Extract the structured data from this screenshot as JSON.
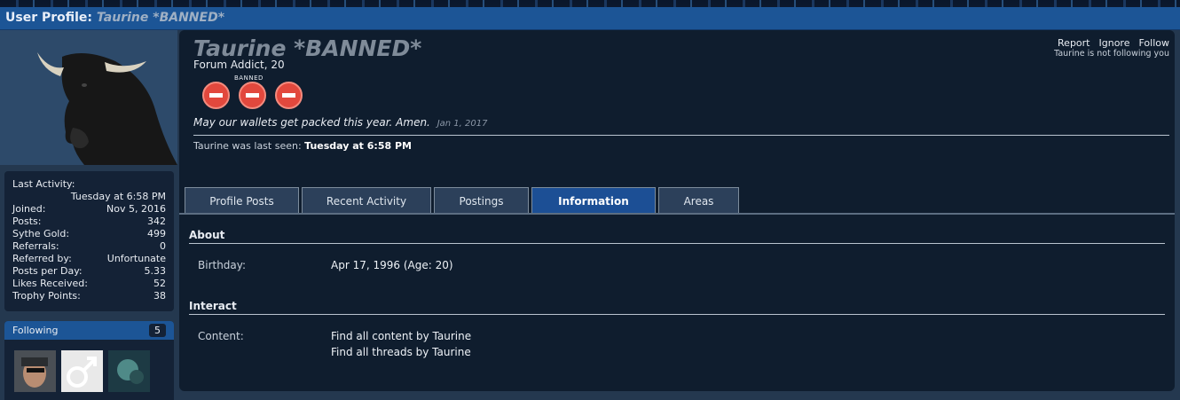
{
  "header": {
    "title_prefix": "User Profile:",
    "title_user": "Taurine *BANNED*"
  },
  "profile": {
    "name": "Taurine *BANNED*",
    "subtitle": "Forum Addict, 20",
    "badge_label": "BANNED",
    "status_text": "May our wallets get packed this year. Amen.",
    "status_date": "Jan 1, 2017",
    "last_seen_label": "Taurine was last seen:",
    "last_seen_value": "Tuesday at 6:58 PM"
  },
  "actions": {
    "report": "Report",
    "ignore": "Ignore",
    "follow": "Follow",
    "note": "Taurine is not following you"
  },
  "stats": {
    "last_activity_label": "Last Activity:",
    "last_activity_value": "Tuesday at 6:58 PM",
    "rows": [
      {
        "label": "Joined:",
        "value": "Nov 5, 2016"
      },
      {
        "label": "Posts:",
        "value": "342"
      },
      {
        "label": "Sythe Gold:",
        "value": "499"
      },
      {
        "label": "Referrals:",
        "value": "0"
      },
      {
        "label": "Referred by:",
        "value": "Unfortunate"
      },
      {
        "label": "Posts per Day:",
        "value": "5.33"
      },
      {
        "label": "Likes Received:",
        "value": "52"
      },
      {
        "label": "Trophy Points:",
        "value": "38"
      }
    ]
  },
  "following": {
    "label": "Following",
    "count": "5"
  },
  "tabs": [
    {
      "label": "Profile Posts"
    },
    {
      "label": "Recent Activity"
    },
    {
      "label": "Postings"
    },
    {
      "label": "Information"
    },
    {
      "label": "Areas"
    }
  ],
  "about": {
    "title": "About",
    "birthday_label": "Birthday:",
    "birthday_value": "Apr 17, 1996 (Age: 20)"
  },
  "interact": {
    "title": "Interact",
    "content_label": "Content:",
    "link_content": "Find all content by Taurine",
    "link_threads": "Find all threads by Taurine"
  },
  "colors": {
    "accent": "#1c5596",
    "panel": "#0f1d2e",
    "banned_red": "#e2483d"
  }
}
